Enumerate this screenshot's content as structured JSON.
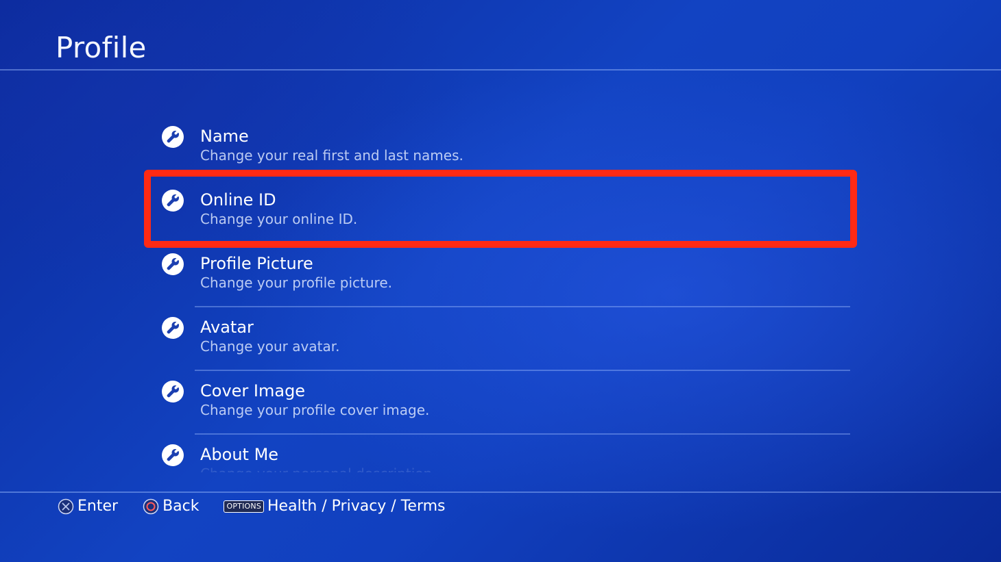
{
  "header": {
    "title": "Profile"
  },
  "menu": {
    "items": [
      {
        "label": "Name",
        "description": "Change your real first and last names.",
        "icon": "wrench-icon"
      },
      {
        "label": "Online ID",
        "description": "Change your online ID.",
        "icon": "wrench-icon",
        "highlighted": true
      },
      {
        "label": "Profile Picture",
        "description": "Change your profile picture.",
        "icon": "wrench-icon"
      },
      {
        "label": "Avatar",
        "description": "Change your avatar.",
        "icon": "wrench-icon"
      },
      {
        "label": "Cover Image",
        "description": "Change your profile cover image.",
        "icon": "wrench-icon"
      },
      {
        "label": "About Me",
        "description": "Change your personal description.",
        "icon": "wrench-icon"
      }
    ]
  },
  "footer": {
    "enter_label": "Enter",
    "back_label": "Back",
    "options_badge": "OPTIONS",
    "options_label": "Health / Privacy / Terms"
  },
  "colors": {
    "background": "#1243c2",
    "highlight_frame": "#ff2a14",
    "text": "#ffffff",
    "icon_fill": "#1b3fb0"
  }
}
